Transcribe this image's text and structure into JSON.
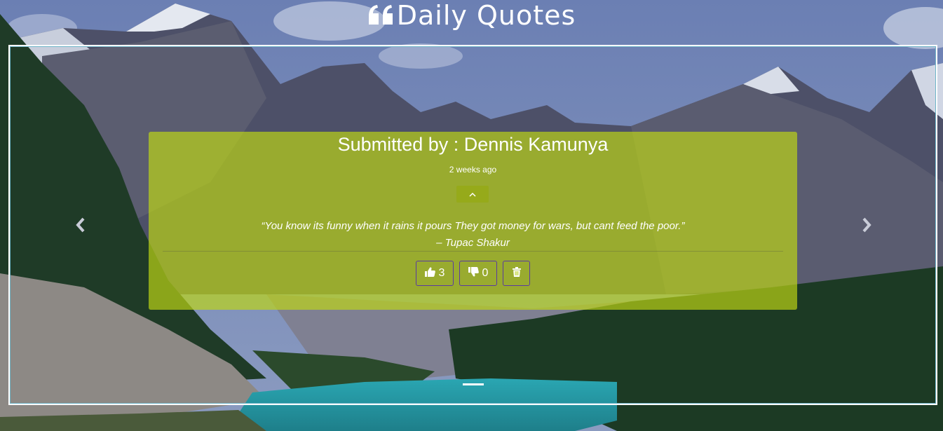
{
  "header": {
    "title": "Daily Quotes"
  },
  "quote": {
    "submitted_by": "Submitted by : Dennis Kamunya",
    "posted_ago": "2 weeks ago",
    "text": "“You know its funny when it rains it pours They got money for wars, but cant feed the poor.”",
    "author": "– Tupac Shakur",
    "upvotes": "3",
    "downvotes": "0"
  },
  "colors": {
    "card_background": "#bed714",
    "button_border": "#5a3aa0",
    "text": "#ffffff"
  },
  "icons": {
    "title": "quote-left-icon",
    "toggle": "chevron-up-icon",
    "upvote": "thumbs-up-icon",
    "downvote": "thumbs-down-icon",
    "delete": "trash-icon",
    "prev": "chevron-left-icon",
    "next": "chevron-right-icon"
  }
}
